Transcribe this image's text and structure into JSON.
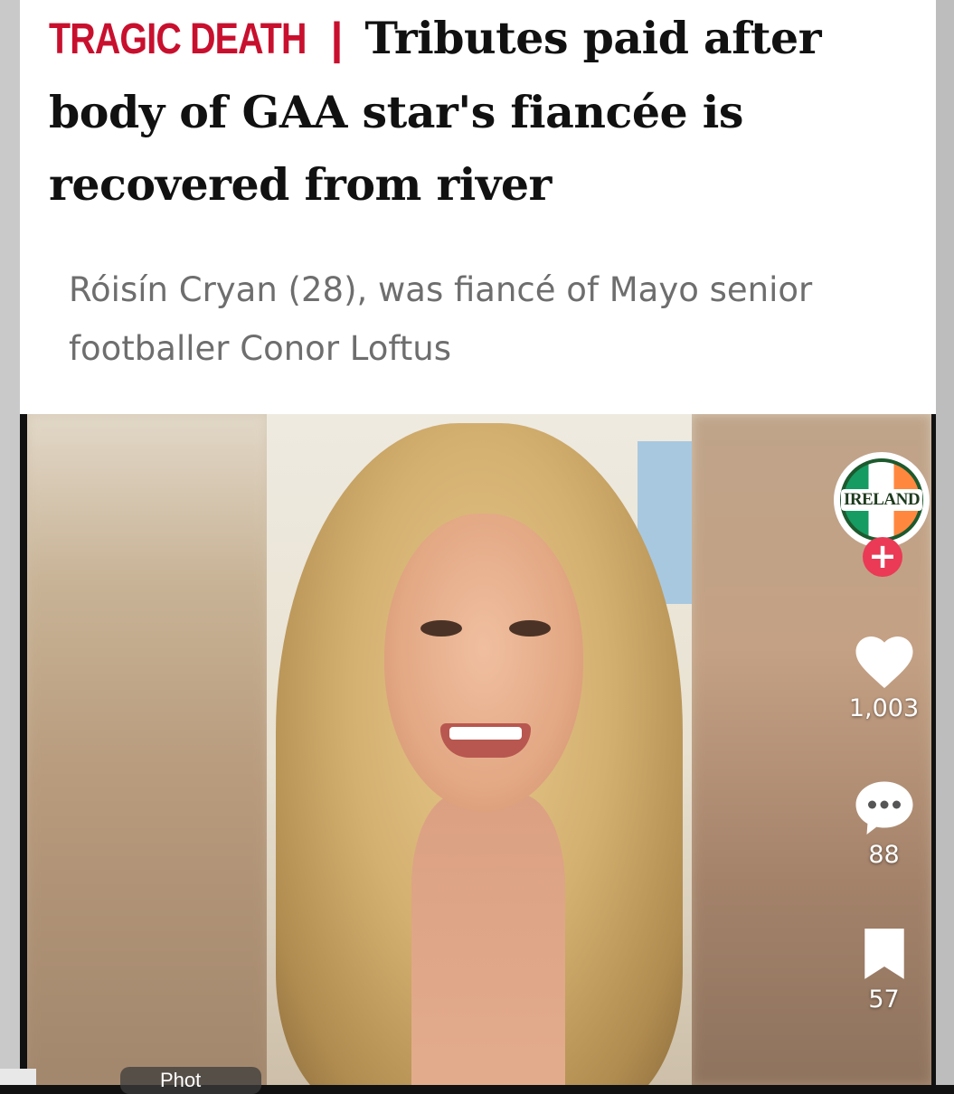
{
  "article": {
    "kicker": "TRAGIC DEATH",
    "separator": "|",
    "headline": "Tributes paid after body of GAA star's fiancée is recovered from river",
    "subheadline": "Róisín Cryan (28), was fiancé of Mayo senior footballer Conor Loftus"
  },
  "profile": {
    "badge_text": "IRELAND",
    "follow_symbol": "+"
  },
  "actions": {
    "likes": "1,003",
    "comments": "88",
    "saves": "57"
  },
  "bottom": {
    "chip_label": "Phot"
  },
  "colors": {
    "kicker": "#c8102e",
    "follow_button": "#ea3a55"
  }
}
